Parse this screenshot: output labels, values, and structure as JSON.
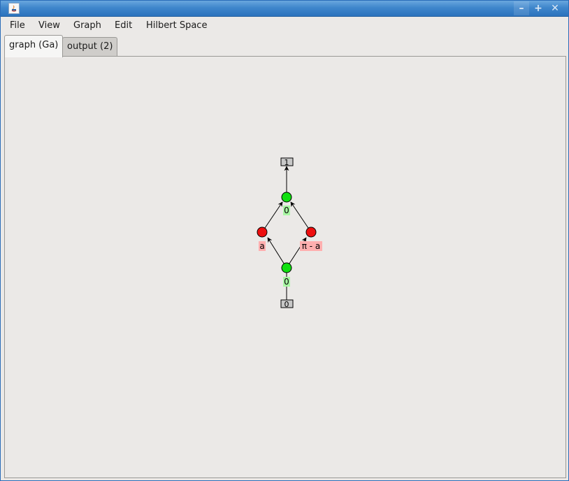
{
  "window": {
    "title": "",
    "controls": {
      "minimize": "–",
      "maximize": "+",
      "close": "✕"
    }
  },
  "menubar": {
    "items": [
      {
        "label": "File"
      },
      {
        "label": "View"
      },
      {
        "label": "Graph"
      },
      {
        "label": "Edit"
      },
      {
        "label": "Hilbert Space"
      }
    ]
  },
  "tabs": [
    {
      "label": "graph (Ga)",
      "active": true
    },
    {
      "label": "output (2)",
      "active": false
    }
  ],
  "graph": {
    "boundary_top": "1",
    "boundary_bottom": "0",
    "green_top_phase": "0",
    "red_left_phase": "a",
    "red_right_phase": "π - a",
    "green_bottom_phase": "0",
    "colors": {
      "green_node": "#10e010",
      "red_node": "#ee0f0f",
      "green_label_bg": "#a8f7a3",
      "red_label_bg": "#ffafaf",
      "boundary_fill": "#c8c8c8"
    }
  }
}
